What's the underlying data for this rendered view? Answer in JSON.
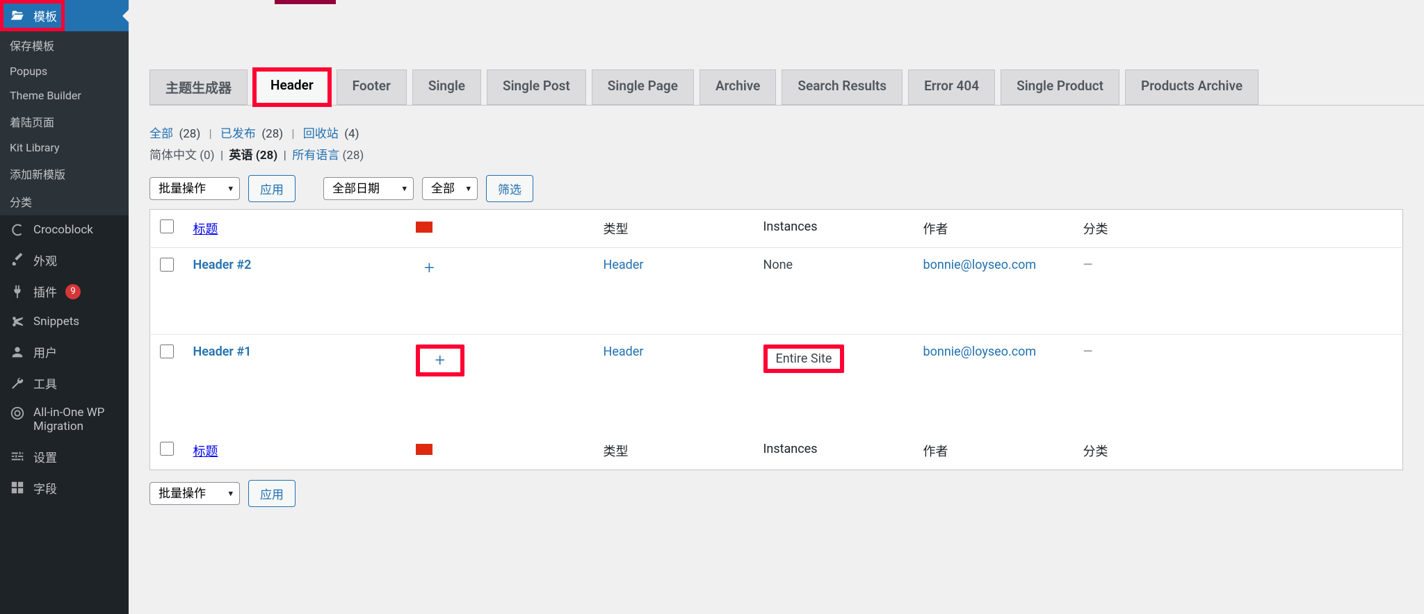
{
  "sidebar": {
    "active": {
      "label": "模板"
    },
    "sub": [
      "保存模板",
      "Popups",
      "Theme Builder",
      "着陆页面",
      "Kit Library",
      "添加新模版",
      "分类"
    ],
    "items": [
      {
        "label": "Crocoblock"
      },
      {
        "label": "外观"
      },
      {
        "label": "插件",
        "badge": "9"
      },
      {
        "label": "Snippets"
      },
      {
        "label": "用户"
      },
      {
        "label": "工具"
      },
      {
        "label": "All-in-One WP Migration"
      },
      {
        "label": "设置"
      },
      {
        "label": "字段"
      }
    ]
  },
  "tabs": [
    "主题生成器",
    "Header",
    "Footer",
    "Single",
    "Single Post",
    "Single Page",
    "Archive",
    "Search Results",
    "Error 404",
    "Single Product",
    "Products Archive"
  ],
  "views": {
    "all": {
      "label": "全部",
      "count": "(28)"
    },
    "published": {
      "label": "已发布",
      "count": "(28)"
    },
    "trash": {
      "label": "回收站",
      "count": "(4)"
    }
  },
  "langs": {
    "zh": {
      "label": "简体中文",
      "count": "(0)"
    },
    "en": {
      "label": "英语",
      "count": "(28)"
    },
    "all": {
      "label": "所有语言",
      "count": "(28)"
    }
  },
  "filters": {
    "bulk": "批量操作",
    "apply": "应用",
    "all_dates": "全部日期",
    "all_type": "全部",
    "filter": "筛选"
  },
  "table": {
    "headers": {
      "title": "标题",
      "type": "类型",
      "instances": "Instances",
      "author": "作者",
      "category": "分类"
    },
    "rows": [
      {
        "title": "Header #2",
        "type": "Header",
        "instances": "None",
        "author": "bonnie@loyseo.com",
        "category": "—",
        "hl_plus": false,
        "hl_inst": false
      },
      {
        "title": "Header #1",
        "type": "Header",
        "instances": "Entire Site",
        "author": "bonnie@loyseo.com",
        "category": "—",
        "hl_plus": true,
        "hl_inst": true
      }
    ]
  }
}
